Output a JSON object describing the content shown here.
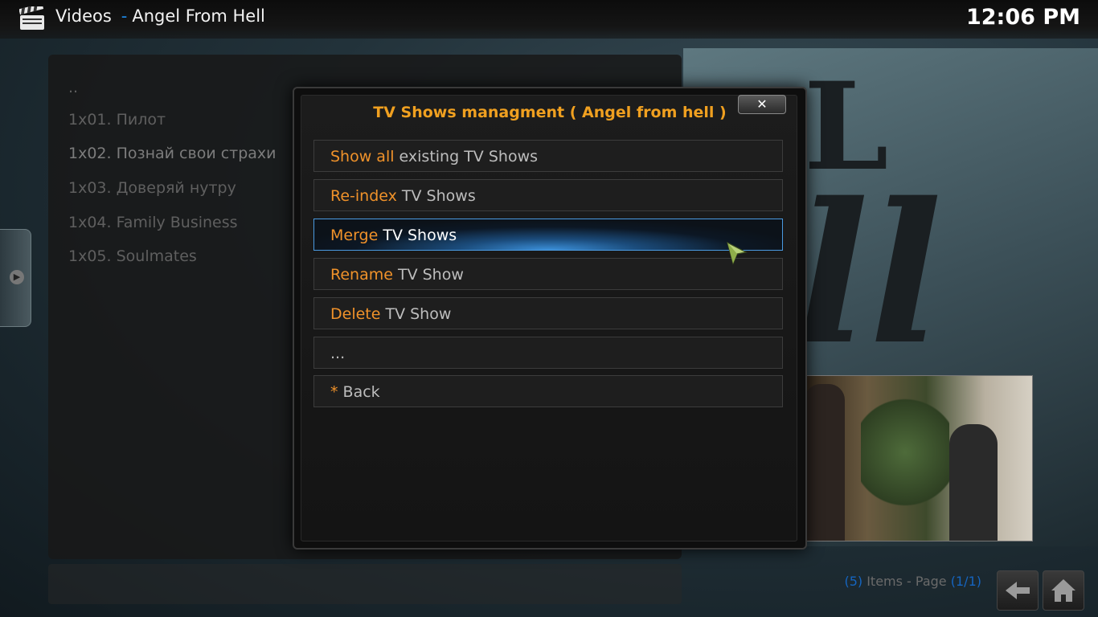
{
  "header": {
    "section": "Videos",
    "separator": "-",
    "subtitle": "Angel From Hell",
    "clock": "12:06 PM"
  },
  "episode_list": {
    "items": [
      {
        "label": ".."
      },
      {
        "label": "1x01. Пилот"
      },
      {
        "label": "1x02. Познай свои страхи"
      },
      {
        "label": "1x03. Доверяй нутру"
      },
      {
        "label": "1x04. Family Business"
      },
      {
        "label": "1x05. Soulmates"
      }
    ]
  },
  "footer": {
    "count_open": "(",
    "count": "5",
    "count_close": ")",
    "items_page_text": " Items - Page ",
    "page_open": "(",
    "page_current": "1",
    "page_sep": "/",
    "page_total": "1",
    "page_close": ")"
  },
  "dialog": {
    "title": "TV Shows managment  ( Angel from hell )",
    "close_label": "✕",
    "items": [
      {
        "keyword": "Show all",
        "rest": " existing TV Shows"
      },
      {
        "keyword": "Re-index",
        "rest": " TV Shows"
      },
      {
        "keyword": "Merge",
        "rest": " TV Shows"
      },
      {
        "keyword": "Rename",
        "rest": " TV Show"
      },
      {
        "keyword": "Delete",
        "rest": " TV Show"
      },
      {
        "keyword": "",
        "rest": "..."
      },
      {
        "keyword": "*",
        "rest": " Back"
      }
    ],
    "focused_index": 2
  },
  "icons": {
    "app": "clapperboard-icon",
    "side": "chevron-right-icon",
    "back": "back-arrow-icon",
    "home": "home-icon",
    "cursor": "mouse-pointer-icon"
  },
  "colors": {
    "accent_orange": "#f0922a",
    "title_orange": "#f0a020",
    "accent_blue": "#1e88e5"
  }
}
